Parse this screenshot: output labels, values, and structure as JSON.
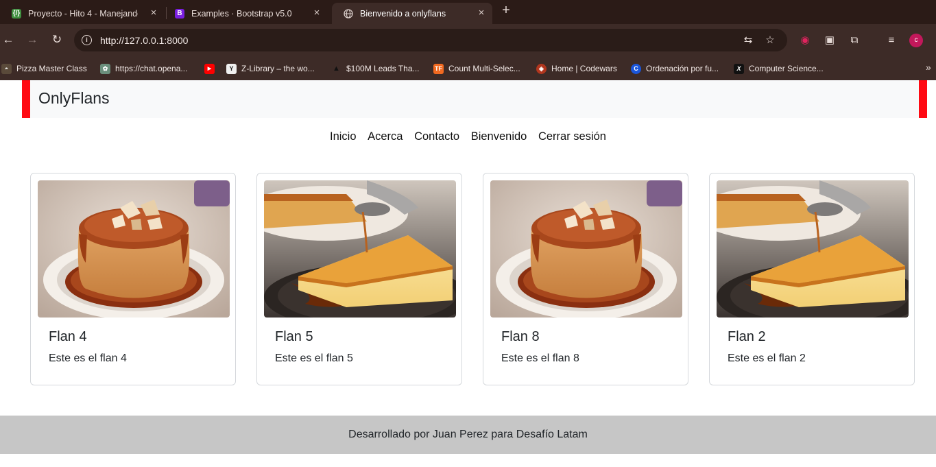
{
  "browser": {
    "tabs": [
      {
        "title": "Proyecto - Hito 4 - Manejando",
        "favicon": "{/}",
        "active": false
      },
      {
        "title": "Examples · Bootstrap v5.0",
        "favicon": "B",
        "active": false
      },
      {
        "title": "Bienvenido a onlyflans",
        "favicon": "globe",
        "active": true
      }
    ],
    "url": "http://127.0.0.1:8000",
    "avatar_letter": "c",
    "bookmarks": [
      {
        "label": "Pizza Master Class",
        "icon": "pizza-icon"
      },
      {
        "label": "https://chat.opena...",
        "icon": "openai-icon"
      },
      {
        "label": "",
        "icon": "youtube-icon"
      },
      {
        "label": "Z-Library – the wo...",
        "icon": "zlibrary-icon"
      },
      {
        "label": "$100M Leads Tha...",
        "icon": "triangle-icon"
      },
      {
        "label": "Count Multi-Selec...",
        "icon": "tf-icon"
      },
      {
        "label": "Home | Codewars",
        "icon": "codewars-icon"
      },
      {
        "label": "Ordenación por fu...",
        "icon": "c-icon"
      },
      {
        "label": "Computer Science...",
        "icon": "x-icon"
      }
    ]
  },
  "site": {
    "brand": "OnlyFlans",
    "nav": [
      "Inicio",
      "Acerca",
      "Contacto",
      "Bienvenido",
      "Cerrar sesión"
    ],
    "cards": [
      {
        "title": "Flan 4",
        "text": "Este es el flan 4",
        "image": "round-flan"
      },
      {
        "title": "Flan 5",
        "text": "Este es el flan 5",
        "image": "flan-slice"
      },
      {
        "title": "Flan 8",
        "text": "Este es el flan 8",
        "image": "round-flan"
      },
      {
        "title": "Flan 2",
        "text": "Este es el flan 2",
        "image": "flan-slice"
      }
    ],
    "footer": "Desarrollado por Juan Perez para Desafío Latam"
  },
  "colors": {
    "accent_bar": "#ff0a13",
    "chrome_dark": "#2b1b17",
    "chrome": "#3d2b27",
    "footer_bg": "#c6c6c6"
  }
}
